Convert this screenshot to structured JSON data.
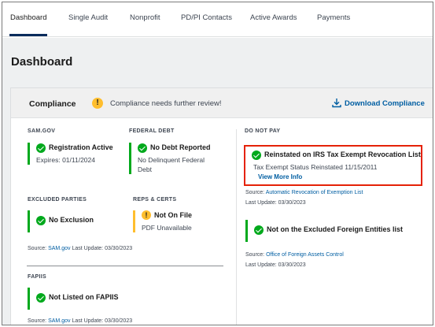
{
  "tabs": [
    "Dashboard",
    "Single Audit",
    "Nonprofit",
    "PD/PI Contacts",
    "Active Awards",
    "Payments"
  ],
  "page_title": "Dashboard",
  "compliance": {
    "title": "Compliance",
    "review": "Compliance needs further review!",
    "download": "Download Compliance"
  },
  "sam": {
    "label": "SAM.GOV",
    "headline": "Registration Active",
    "sub": "Expires: 01/11/2024"
  },
  "debt": {
    "label": "FEDERAL DEBT",
    "headline": "No Debt Reported",
    "sub": "No Delinquent Federal Debt"
  },
  "excluded": {
    "label": "EXCLUDED PARTIES",
    "headline": "No Exclusion"
  },
  "reps": {
    "label": "REPS & CERTS",
    "headline": "Not On File",
    "sub": "PDF Unavailable"
  },
  "left_source": {
    "prefix": "Source:",
    "link": "SAM.gov",
    "update": "Last Update: 03/30/2023"
  },
  "fapiis": {
    "label": "FAPIIS",
    "headline": "Not Listed on FAPIIS",
    "source_prefix": "Source:",
    "source_link": "SAM.gov",
    "update": "Last Update: 03/30/2023"
  },
  "do_not_pay": {
    "label": "DO NOT PAY",
    "irs": {
      "headline": "Reinstated on IRS Tax Exempt Revocation List",
      "sub": "Tax Exempt Status Reinstated 11/15/2011",
      "view_more": "View More Info",
      "source_prefix": "Source:",
      "source_link": "Automatic Revocation of Exemption List",
      "update": "Last Update: 03/30/2023"
    },
    "foreign": {
      "headline": "Not on the Excluded Foreign Entities list",
      "source_prefix": "Source:",
      "source_link": "Office of Foreign Assets Control",
      "update": "Last Update: 03/30/2023"
    }
  },
  "colors": {
    "success": "#00a91c",
    "warning": "#ffbe2e",
    "link": "#005ea2",
    "highlight": "#e52207"
  },
  "icons": [
    "check-circle-icon",
    "warning-icon",
    "download-icon"
  ]
}
